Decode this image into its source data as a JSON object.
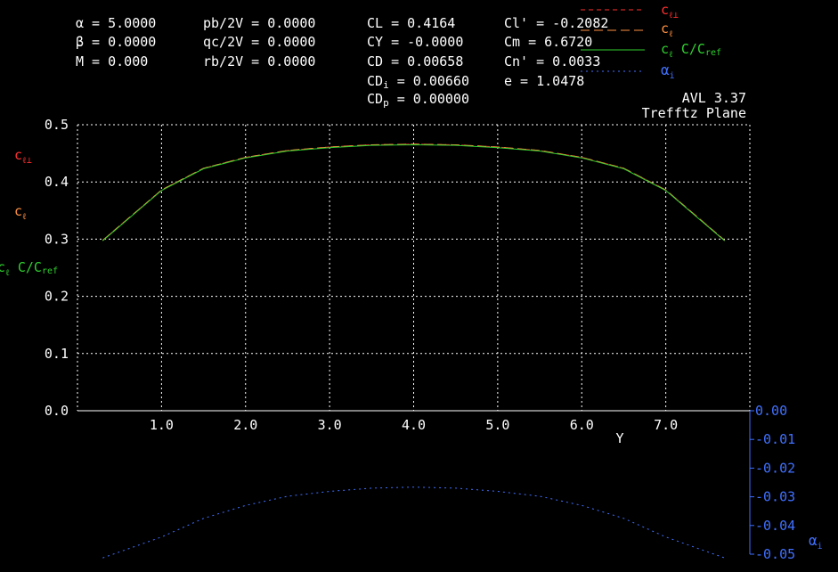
{
  "header": {
    "params": [
      {
        "sym": "α",
        "label": " = 5.0000"
      },
      {
        "sym": "β",
        "label": " = 0.0000"
      },
      {
        "sym": "",
        "label": "M = 0.000"
      }
    ],
    "rates": [
      "pb/2V = 0.0000",
      "qc/2V = 0.0000",
      "rb/2V = 0.0000"
    ],
    "coeffs1": [
      {
        "name": "CL",
        "sub": "",
        "value": " = 0.4164"
      },
      {
        "name": "CY",
        "sub": "",
        "value": " = -0.0000"
      },
      {
        "name": "CD",
        "sub": "",
        "value": " = 0.00658"
      },
      {
        "name": "CD",
        "sub": "i",
        "value": " = 0.00660"
      },
      {
        "name": "CD",
        "sub": "p",
        "value": " = 0.00000"
      }
    ],
    "coeffs2": [
      "Cl' = -0.2082",
      "Cm = 6.6720",
      "Cn' = 0.0033",
      " e = 1.0478"
    ],
    "version": "AVL 3.37",
    "view": "Trefftz Plane"
  },
  "chart_data": {
    "type": "line",
    "xlabel": "Y",
    "ylim": [
      0,
      0.5
    ],
    "y_ticks": [
      "0.0",
      "0.1",
      "0.2",
      "0.3",
      "0.4",
      "0.5"
    ],
    "xlim": [
      0,
      8
    ],
    "x_ticks": [
      "1.0",
      "2.0",
      "3.0",
      "4.0",
      "5.0",
      "6.0",
      "7.0"
    ],
    "y2lim": [
      -0.05,
      0
    ],
    "y2_ticks": [
      "0.00",
      "-0.01",
      "-0.02",
      "-0.03",
      "-0.04",
      "-0.05"
    ],
    "grid": true,
    "series": [
      {
        "key": "cl_perp",
        "color": "#ff3030",
        "dash": "5,4",
        "label_main": "c",
        "label_sub": "ℓ⊥",
        "x": [
          0.3,
          1.0,
          1.5,
          2.0,
          2.5,
          3.0,
          3.5,
          4.0,
          4.5,
          5.0,
          5.5,
          6.0,
          6.5,
          7.0,
          7.7
        ],
        "values": [
          0.298,
          0.386,
          0.424,
          0.443,
          0.455,
          0.461,
          0.465,
          0.466,
          0.465,
          0.461,
          0.455,
          0.443,
          0.424,
          0.386,
          0.298
        ]
      },
      {
        "key": "cl",
        "color": "#ff9040",
        "dash": "10,5",
        "label_main": "c",
        "label_sub": "ℓ",
        "x": [
          0.3,
          1.0,
          1.5,
          2.0,
          2.5,
          3.0,
          3.5,
          4.0,
          4.5,
          5.0,
          5.5,
          6.0,
          6.5,
          7.0,
          7.7
        ],
        "values": [
          0.298,
          0.386,
          0.424,
          0.443,
          0.455,
          0.461,
          0.465,
          0.466,
          0.465,
          0.461,
          0.455,
          0.443,
          0.424,
          0.386,
          0.298
        ]
      },
      {
        "key": "clc",
        "color": "#30d030",
        "dash": "",
        "label_main": "c",
        "label_sub": "ℓ",
        "label_rest": " C/C",
        "label_rest_sub": "ref",
        "x": [
          0.3,
          1.0,
          1.5,
          2.0,
          2.5,
          3.0,
          3.5,
          4.0,
          4.5,
          5.0,
          5.5,
          6.0,
          6.5,
          7.0,
          7.7
        ],
        "values": [
          0.297,
          0.385,
          0.423,
          0.442,
          0.454,
          0.46,
          0.464,
          0.465,
          0.464,
          0.46,
          0.454,
          0.442,
          0.423,
          0.385,
          0.297
        ]
      },
      {
        "key": "alpha_i",
        "color": "#4070ff",
        "dash": "2,4",
        "axis": "y2",
        "label_main": "α",
        "label_sub": "i",
        "x": [
          0.3,
          1.0,
          1.5,
          2.0,
          2.5,
          3.0,
          3.5,
          4.0,
          4.5,
          5.0,
          5.5,
          6.0,
          6.5,
          7.0,
          7.7
        ],
        "values": [
          -0.0513,
          -0.044,
          -0.0375,
          -0.033,
          -0.0298,
          -0.0281,
          -0.027,
          -0.0266,
          -0.027,
          -0.0281,
          -0.0298,
          -0.033,
          -0.0375,
          -0.044,
          -0.0513
        ]
      }
    ]
  }
}
